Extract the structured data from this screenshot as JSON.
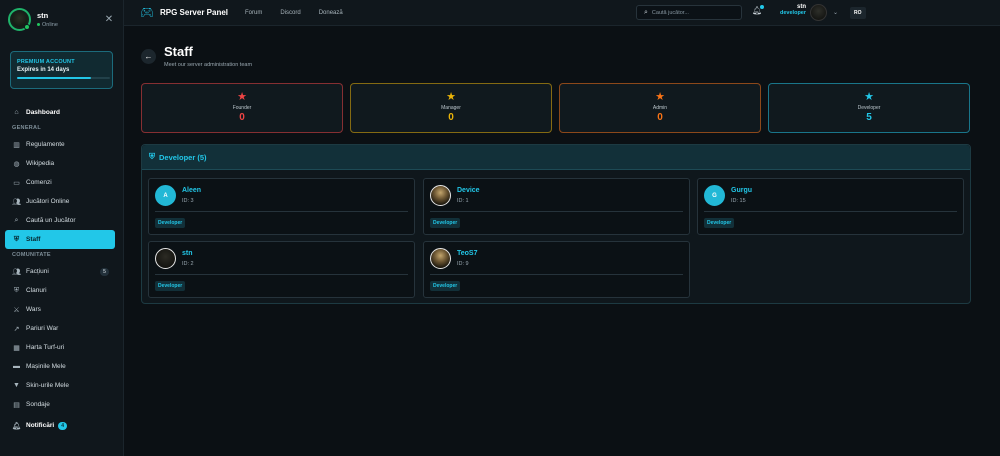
{
  "sidebar": {
    "user": {
      "name": "stn",
      "status": "Online"
    },
    "premium": {
      "title": "PREMIUM ACCOUNT",
      "expires": "Expires in 14 days",
      "progress": 0.8
    },
    "dashboard": "Dashboard",
    "section_general": "GENERAL",
    "general": [
      {
        "label": "Regulamente",
        "icon": "book-icon"
      },
      {
        "label": "Wikipedia",
        "icon": "globe-icon"
      },
      {
        "label": "Comenzi",
        "icon": "terminal-icon"
      },
      {
        "label": "Jucători Online",
        "icon": "users-icon"
      },
      {
        "label": "Caută un Jucător",
        "icon": "search-icon"
      },
      {
        "label": "Staff",
        "icon": "shield-icon",
        "active": true
      }
    ],
    "section_community": "COMUNITATE",
    "community": [
      {
        "label": "Facțiuni",
        "icon": "users-icon",
        "badge": "5"
      },
      {
        "label": "Clanuri",
        "icon": "shield-icon"
      },
      {
        "label": "Wars",
        "icon": "swords-icon"
      },
      {
        "label": "Pariuri War",
        "icon": "trend-icon"
      },
      {
        "label": "Harta Turf-uri",
        "icon": "map-icon"
      },
      {
        "label": "Mașinile Mele",
        "icon": "car-icon"
      },
      {
        "label": "Skin-urile Mele",
        "icon": "shirt-icon"
      },
      {
        "label": "Sondaje",
        "icon": "poll-icon"
      }
    ],
    "notifications": {
      "label": "Notificări",
      "badge": "4"
    }
  },
  "header": {
    "brand": "RPG Server Panel",
    "nav": [
      "Forum",
      "Discord",
      "Donează"
    ],
    "search_placeholder": "Caută jucător...",
    "user": {
      "name": "stn",
      "role": "developer"
    },
    "lang": "RO"
  },
  "page": {
    "title": "Staff",
    "subtitle": "Meet our server administration team"
  },
  "ranks": [
    {
      "label": "Founder",
      "count": "0",
      "color": "#ef4444"
    },
    {
      "label": "Manager",
      "count": "0",
      "color": "#eab308"
    },
    {
      "label": "Admin",
      "count": "0",
      "color": "#f97316"
    },
    {
      "label": "Developer",
      "count": "5",
      "color": "#22c7e8"
    }
  ],
  "group": {
    "title": "Developer (5)",
    "members": [
      {
        "name": "Aleen",
        "id": "ID: 3",
        "role": "Developer",
        "avatar": "A"
      },
      {
        "name": "Device",
        "id": "ID: 1",
        "role": "Developer",
        "avatar": ""
      },
      {
        "name": "Gurgu",
        "id": "ID: 15",
        "role": "Developer",
        "avatar": "G"
      },
      {
        "name": "stn",
        "id": "ID: 2",
        "role": "Developer",
        "avatar": ""
      },
      {
        "name": "TeoS7",
        "id": "ID: 9",
        "role": "Developer",
        "avatar": ""
      }
    ]
  }
}
